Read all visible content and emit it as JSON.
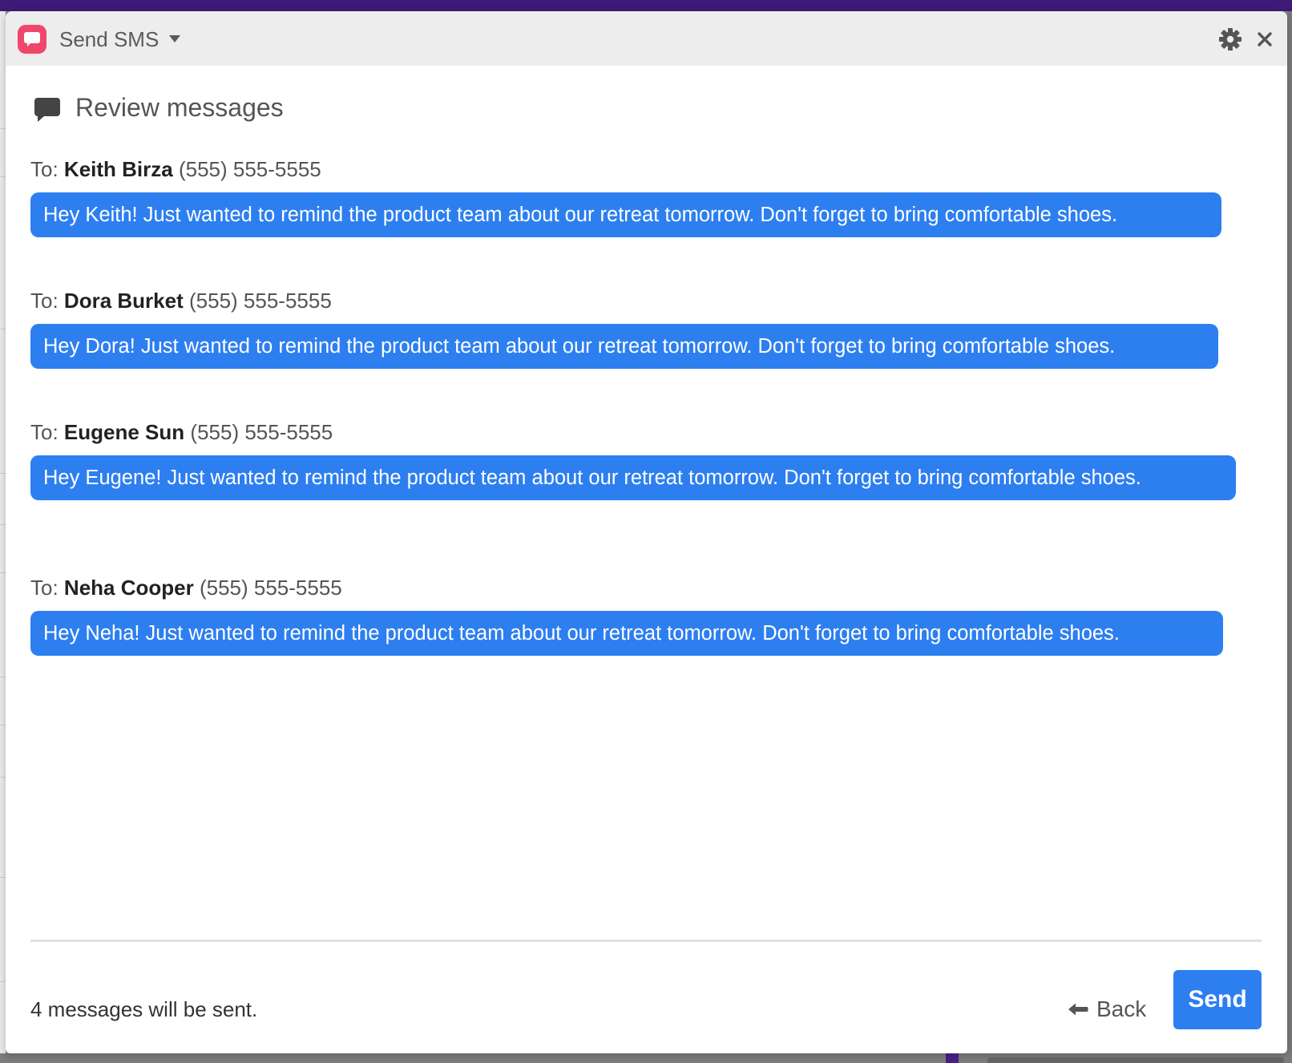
{
  "app": {
    "title": "Send SMS",
    "icon": "sms-app-icon",
    "accent_color": "#f0466b"
  },
  "header": {
    "title": "Review messages",
    "icon": "speech-bubble-icon"
  },
  "messages": [
    {
      "to_prefix": "To:",
      "name": "Keith Birza",
      "phone": "(555) 555-5555",
      "body": "Hey Keith! Just wanted to remind the product team about our retreat tomorrow. Don't forget to bring comfortable shoes."
    },
    {
      "to_prefix": "To:",
      "name": "Dora Burket",
      "phone": "(555) 555-5555",
      "body": "Hey Dora! Just wanted to remind the product team about our retreat tomorrow. Don't forget to bring comfortable shoes."
    },
    {
      "to_prefix": "To:",
      "name": "Eugene Sun",
      "phone": "(555) 555-5555",
      "body": "Hey Eugene! Just wanted to remind the product team about our retreat tomorrow. Don't forget to bring comfortable shoes."
    },
    {
      "to_prefix": "To:",
      "name": "Neha Cooper",
      "phone": "(555) 555-5555",
      "body": "Hey Neha! Just wanted to remind the product team about our retreat tomorrow. Don't forget to bring comfortable shoes."
    }
  ],
  "footer": {
    "status": "4 messages will be sent.",
    "back_label": "Back",
    "send_label": "Send"
  },
  "colors": {
    "bubble": "#2d7ff0",
    "send_button": "#2d7ff0",
    "title_bar": "#ededed"
  }
}
